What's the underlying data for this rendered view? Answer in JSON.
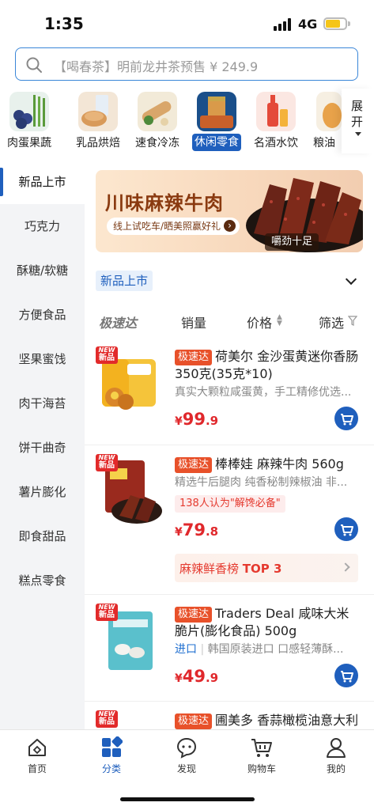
{
  "status_bar": {
    "time": "1:35",
    "network": "4G"
  },
  "search": {
    "placeholder": "【喝春茶】明前龙井茶预售 ¥ 249.9"
  },
  "categories": [
    {
      "label": "肉蛋果蔬",
      "icon": "produce-icon",
      "active": false
    },
    {
      "label": "乳品烘焙",
      "icon": "bakery-icon",
      "active": false
    },
    {
      "label": "速食冷冻",
      "icon": "frozen-food-icon",
      "active": false
    },
    {
      "label": "休闲零食",
      "icon": "snacks-icon",
      "active": true
    },
    {
      "label": "名酒水饮",
      "icon": "drinks-icon",
      "active": false
    },
    {
      "label": "粮油",
      "icon": "grain-oil-icon",
      "active": false
    }
  ],
  "expand_label": "展开",
  "sidebar": {
    "items": [
      "新品上市",
      "巧克力",
      "酥糖/软糖",
      "方便食品",
      "坚果蜜饯",
      "肉干海苔",
      "饼干曲奇",
      "薯片膨化",
      "即食甜品",
      "糕点零食"
    ],
    "active_index": 0
  },
  "banner": {
    "title": "川味麻辣牛肉",
    "subtitle": "线上试吃车/晒美照赢好礼",
    "badge": "嚼劲十足"
  },
  "section": {
    "title": "新品上市"
  },
  "sort_bar": {
    "fast": "极速达",
    "sales": "销量",
    "price": "价格",
    "filter": "筛选"
  },
  "new_tag": {
    "en": "NEW",
    "zh": "新品"
  },
  "products": [
    {
      "tag": "极速达",
      "title": "荷美尔 金沙蛋黄迷你香肠350克(35克*10)",
      "desc": "真实大颗粒咸蛋黄，手工精修优选...",
      "price_symbol": "¥",
      "price_int": "99",
      "price_dec": ".9"
    },
    {
      "tag": "极速达",
      "title": "棒棒娃 麻辣牛肉 560g",
      "desc": "精选牛后腿肉 纯香秘制辣椒油 非...",
      "badge": "138人认为\"解馋必备\"",
      "price_symbol": "¥",
      "price_int": "79",
      "price_dec": ".8",
      "rank_text": "麻辣鲜香榜",
      "rank_top": "TOP 3"
    },
    {
      "tag": "极速达",
      "title": "Traders Deal 咸味大米脆片(膨化食品) 500g",
      "desc_highlight": "进口",
      "desc_sep": " | ",
      "desc": "韩国原装进口 口感轻薄酥...",
      "price_symbol": "¥",
      "price_int": "49",
      "price_dec": ".9"
    },
    {
      "tag": "极速达",
      "title": "圃美多 香蒜橄榄油意大利"
    }
  ],
  "bottom_nav": [
    {
      "label": "首页",
      "icon": "home-icon",
      "active": false
    },
    {
      "label": "分类",
      "icon": "category-icon",
      "active": true
    },
    {
      "label": "发现",
      "icon": "discover-icon",
      "active": false
    },
    {
      "label": "购物车",
      "icon": "cart-icon",
      "active": false
    },
    {
      "label": "我的",
      "icon": "profile-icon",
      "active": false
    }
  ],
  "colors": {
    "accent": "#1f5fbd",
    "price": "#e0282c",
    "fast_tag": "#e8512a",
    "new_tag": "#e22a2a"
  }
}
